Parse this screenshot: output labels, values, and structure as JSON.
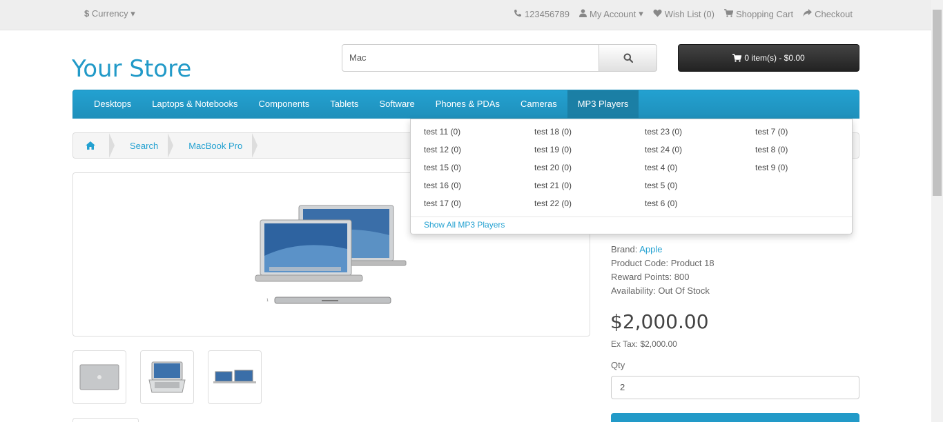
{
  "topbar": {
    "currency_symbol": "$",
    "currency_label": "Currency",
    "phone": "123456789",
    "my_account": "My Account",
    "wish_list": "Wish List (0)",
    "shopping_cart": "Shopping Cart",
    "checkout": "Checkout"
  },
  "header": {
    "logo": "Your Store",
    "search_value": "Mac",
    "cart_label": "0 item(s) - $0.00"
  },
  "nav": {
    "items": [
      "Desktops",
      "Laptops & Notebooks",
      "Components",
      "Tablets",
      "Software",
      "Phones & PDAs",
      "Cameras",
      "MP3 Players"
    ],
    "active": "MP3 Players"
  },
  "breadcrumb": {
    "items": [
      "Search",
      "MacBook Pro"
    ]
  },
  "dropdown": {
    "columns": [
      [
        "test 11 (0)",
        "test 12 (0)",
        "test 15 (0)",
        "test 16 (0)",
        "test 17 (0)"
      ],
      [
        "test 18 (0)",
        "test 19 (0)",
        "test 20 (0)",
        "test 21 (0)",
        "test 22 (0)"
      ],
      [
        "test 23 (0)",
        "test 24 (0)",
        "test 4 (0)",
        "test 5 (0)",
        "test 6 (0)"
      ],
      [
        "test 7 (0)",
        "test 8 (0)",
        "test 9 (0)"
      ]
    ],
    "show_all": "Show All MP3 Players"
  },
  "product": {
    "brand_label": "Brand:",
    "brand": "Apple",
    "code_label": "Product Code:",
    "code": "Product 18",
    "reward_label": "Reward Points:",
    "reward": "800",
    "availability_label": "Availability:",
    "availability": "Out Of Stock",
    "price": "$2,000.00",
    "ex_tax": "Ex Tax: $2,000.00",
    "qty_label": "Qty",
    "qty_value": "2"
  },
  "colors": {
    "accent": "#229ac8",
    "nav_active": "#1b7fa5"
  }
}
